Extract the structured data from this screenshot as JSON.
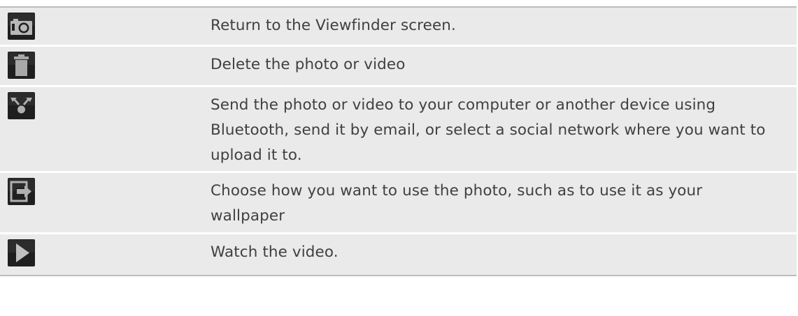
{
  "rows": [
    {
      "icon": "camera-icon",
      "description": "Return to the Viewfinder screen."
    },
    {
      "icon": "trash-icon",
      "description": "Delete the photo or video"
    },
    {
      "icon": "share-icon",
      "description": "Send the photo or video to your computer or another device using Bluetooth, send it by email, or select a social network where you want to upload it to."
    },
    {
      "icon": "export-icon",
      "description": "Choose how you want to use the photo, such as to use it as your wallpaper"
    },
    {
      "icon": "play-icon",
      "description": "Watch the video."
    }
  ]
}
